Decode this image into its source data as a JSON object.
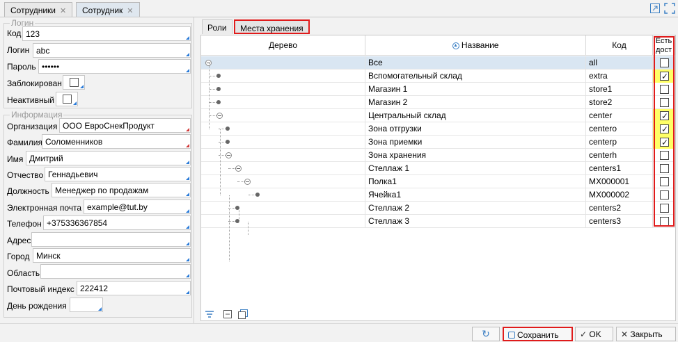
{
  "window_tabs": [
    {
      "label": "Сотрудники",
      "close": "✕"
    },
    {
      "label": "Сотрудник",
      "close": "✕"
    }
  ],
  "login_group": {
    "title": "Логин",
    "code_label": "Код",
    "code_value": "123",
    "login_label": "Логин",
    "login_value": "abc",
    "password_label": "Пароль",
    "password_value": "••••••",
    "blocked_label": "Заблокирован",
    "inactive_label": "Неактивный"
  },
  "info_group": {
    "title": "Информация",
    "fields": [
      {
        "label": "Организация",
        "value": "ООО ЕвроСнекПродукт"
      },
      {
        "label": "Фамилия",
        "value": "Соломенников"
      },
      {
        "label": "Имя",
        "value": "Дмитрий"
      },
      {
        "label": "Отчество",
        "value": "Геннадьевич"
      },
      {
        "label": "Должность",
        "value": "Менеджер по продажам"
      },
      {
        "label": "Электронная почта",
        "value": "example@tut.by"
      },
      {
        "label": "Телефон",
        "value": "+375336367854"
      },
      {
        "label": "Адрес",
        "value": ""
      },
      {
        "label": "Город",
        "value": "Минск"
      },
      {
        "label": "Область",
        "value": ""
      },
      {
        "label": "Почтовый индекс",
        "value": "222412"
      },
      {
        "label": "День рождения",
        "value": ""
      }
    ]
  },
  "inner_tabs": [
    {
      "label": "Роли"
    },
    {
      "label": "Места хранения"
    }
  ],
  "grid": {
    "columns": {
      "tree": "Дерево",
      "name": "Название",
      "code": "Код",
      "access": "Есть дост"
    },
    "rows": [
      {
        "name": "Все",
        "code": "all",
        "access": false
      },
      {
        "name": "Вспомогательный склад",
        "code": "extra",
        "access": true
      },
      {
        "name": "Магазин 1",
        "code": "store1",
        "access": false
      },
      {
        "name": "Магазин 2",
        "code": "store2",
        "access": false
      },
      {
        "name": "Центральный склад",
        "code": "center",
        "access": true
      },
      {
        "name": "Зона отгрузки",
        "code": "centero",
        "access": true
      },
      {
        "name": "Зона приемки",
        "code": "centerp",
        "access": true
      },
      {
        "name": "Зона хранения",
        "code": "centerh",
        "access": false
      },
      {
        "name": "Стеллаж 1",
        "code": "centers1",
        "access": false
      },
      {
        "name": "Полка1",
        "code": "MX000001",
        "access": false
      },
      {
        "name": "Ячейка1",
        "code": "MX000002",
        "access": false
      },
      {
        "name": "Стеллаж 2",
        "code": "centers2",
        "access": false
      },
      {
        "name": "Стеллаж 3",
        "code": "centers3",
        "access": false
      }
    ]
  },
  "buttons": {
    "refresh_icon": "↻",
    "save": "Сохранить",
    "ok": "OK",
    "close": "Закрыть"
  },
  "colors": {
    "accent_red": "#e01b1b",
    "highlight_yellow": "#ffff66",
    "selection": "#d9e6f2"
  }
}
